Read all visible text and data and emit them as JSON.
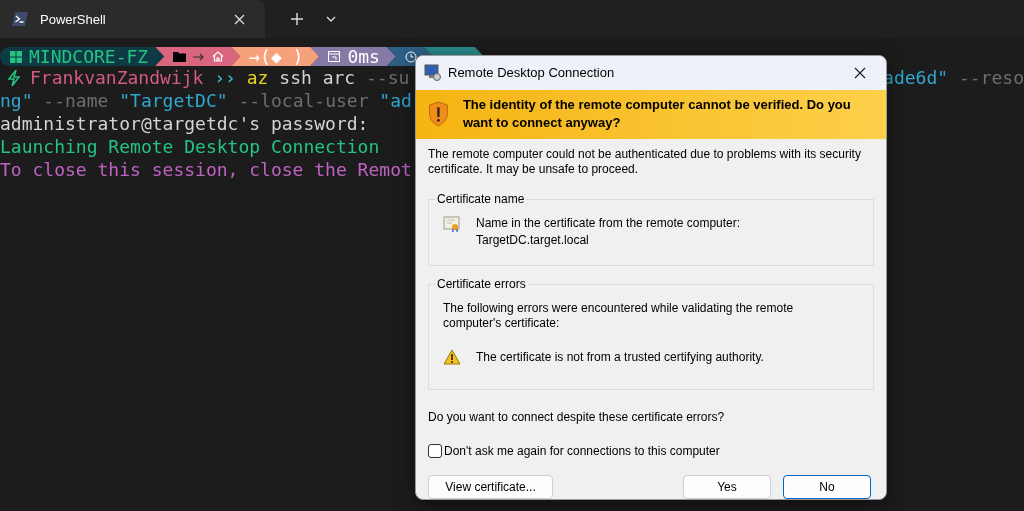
{
  "tabs": [
    {
      "title": "PowerShell",
      "selected": true
    }
  ],
  "prompt_segments": [
    {
      "kind": "host",
      "text": "MINDCORE-FZ",
      "color": "#0d3a44"
    },
    {
      "kind": "path",
      "color": "#d9657f"
    },
    {
      "kind": "git",
      "text": "→(◆ )",
      "color": "#f7a07c"
    },
    {
      "kind": "duration",
      "text": "0ms",
      "color": "#8679a6"
    },
    {
      "kind": "time",
      "color": "#2e5f86"
    },
    {
      "kind": "blank",
      "color": "#2a8a8c"
    }
  ],
  "terminal_lines": [
    {
      "kind": "prompt",
      "spans": [
        {
          "text": "FrankvanZandwijk",
          "color": "#d45b82"
        },
        {
          "text": "››",
          "color": "#3ec6d6"
        },
        {
          "text": "az",
          "color": "#e6d51c"
        },
        {
          "text": "ssh arc",
          "color": "#d4d4d4"
        },
        {
          "text": "--su",
          "color": "#6e6e6e"
        }
      ],
      "right": [
        {
          "text": "ade6d\"",
          "color": "#2fa8d0"
        },
        {
          "text": "--reso",
          "color": "#6e6e6e"
        }
      ]
    },
    {
      "kind": "plain",
      "spans": [
        {
          "text": "ng\"",
          "color": "#2fa8d0"
        },
        {
          "text": "--name",
          "color": "#6e6e6e"
        },
        {
          "text": "\"TargetDC\"",
          "color": "#2fa8d0"
        },
        {
          "text": "--local-user",
          "color": "#6e6e6e"
        },
        {
          "text": "\"ad",
          "color": "#2fa8d0"
        }
      ]
    },
    {
      "kind": "plain",
      "spans": [
        {
          "text": "administrator@targetdc's password:",
          "color": "#d4d4d4"
        }
      ]
    },
    {
      "kind": "plain",
      "spans": [
        {
          "text": "Launching Remote Desktop Connection",
          "color": "#23c483"
        }
      ]
    },
    {
      "kind": "plain",
      "spans": [
        {
          "text": "To close this session, close the Remot",
          "color": "#c062c4"
        }
      ]
    }
  ],
  "dialog": {
    "title": "Remote Desktop Connection",
    "warning": "The identity of the remote computer cannot be verified. Do you want to connect anyway?",
    "intro": "The remote computer could not be authenticated due to problems with its security certificate. It may be unsafe to proceed.",
    "groups": [
      {
        "kind": "name",
        "title": "Certificate name",
        "label": "Name in the certificate from the remote computer:",
        "value": "TargetDC.target.local"
      },
      {
        "kind": "errors",
        "title": "Certificate errors",
        "text": "The following errors were encountered while validating the remote computer's certificate:",
        "items": [
          "The certificate is not from a trusted certifying authority."
        ]
      }
    ],
    "question": "Do you want to connect despite these certificate errors?",
    "checkbox": {
      "label": "Don't ask me again for connections to this computer",
      "checked": false
    },
    "buttons": [
      {
        "label": "View certificate...",
        "default": false
      },
      {
        "label": "Yes",
        "default": false
      },
      {
        "label": "No",
        "default": true
      }
    ]
  }
}
